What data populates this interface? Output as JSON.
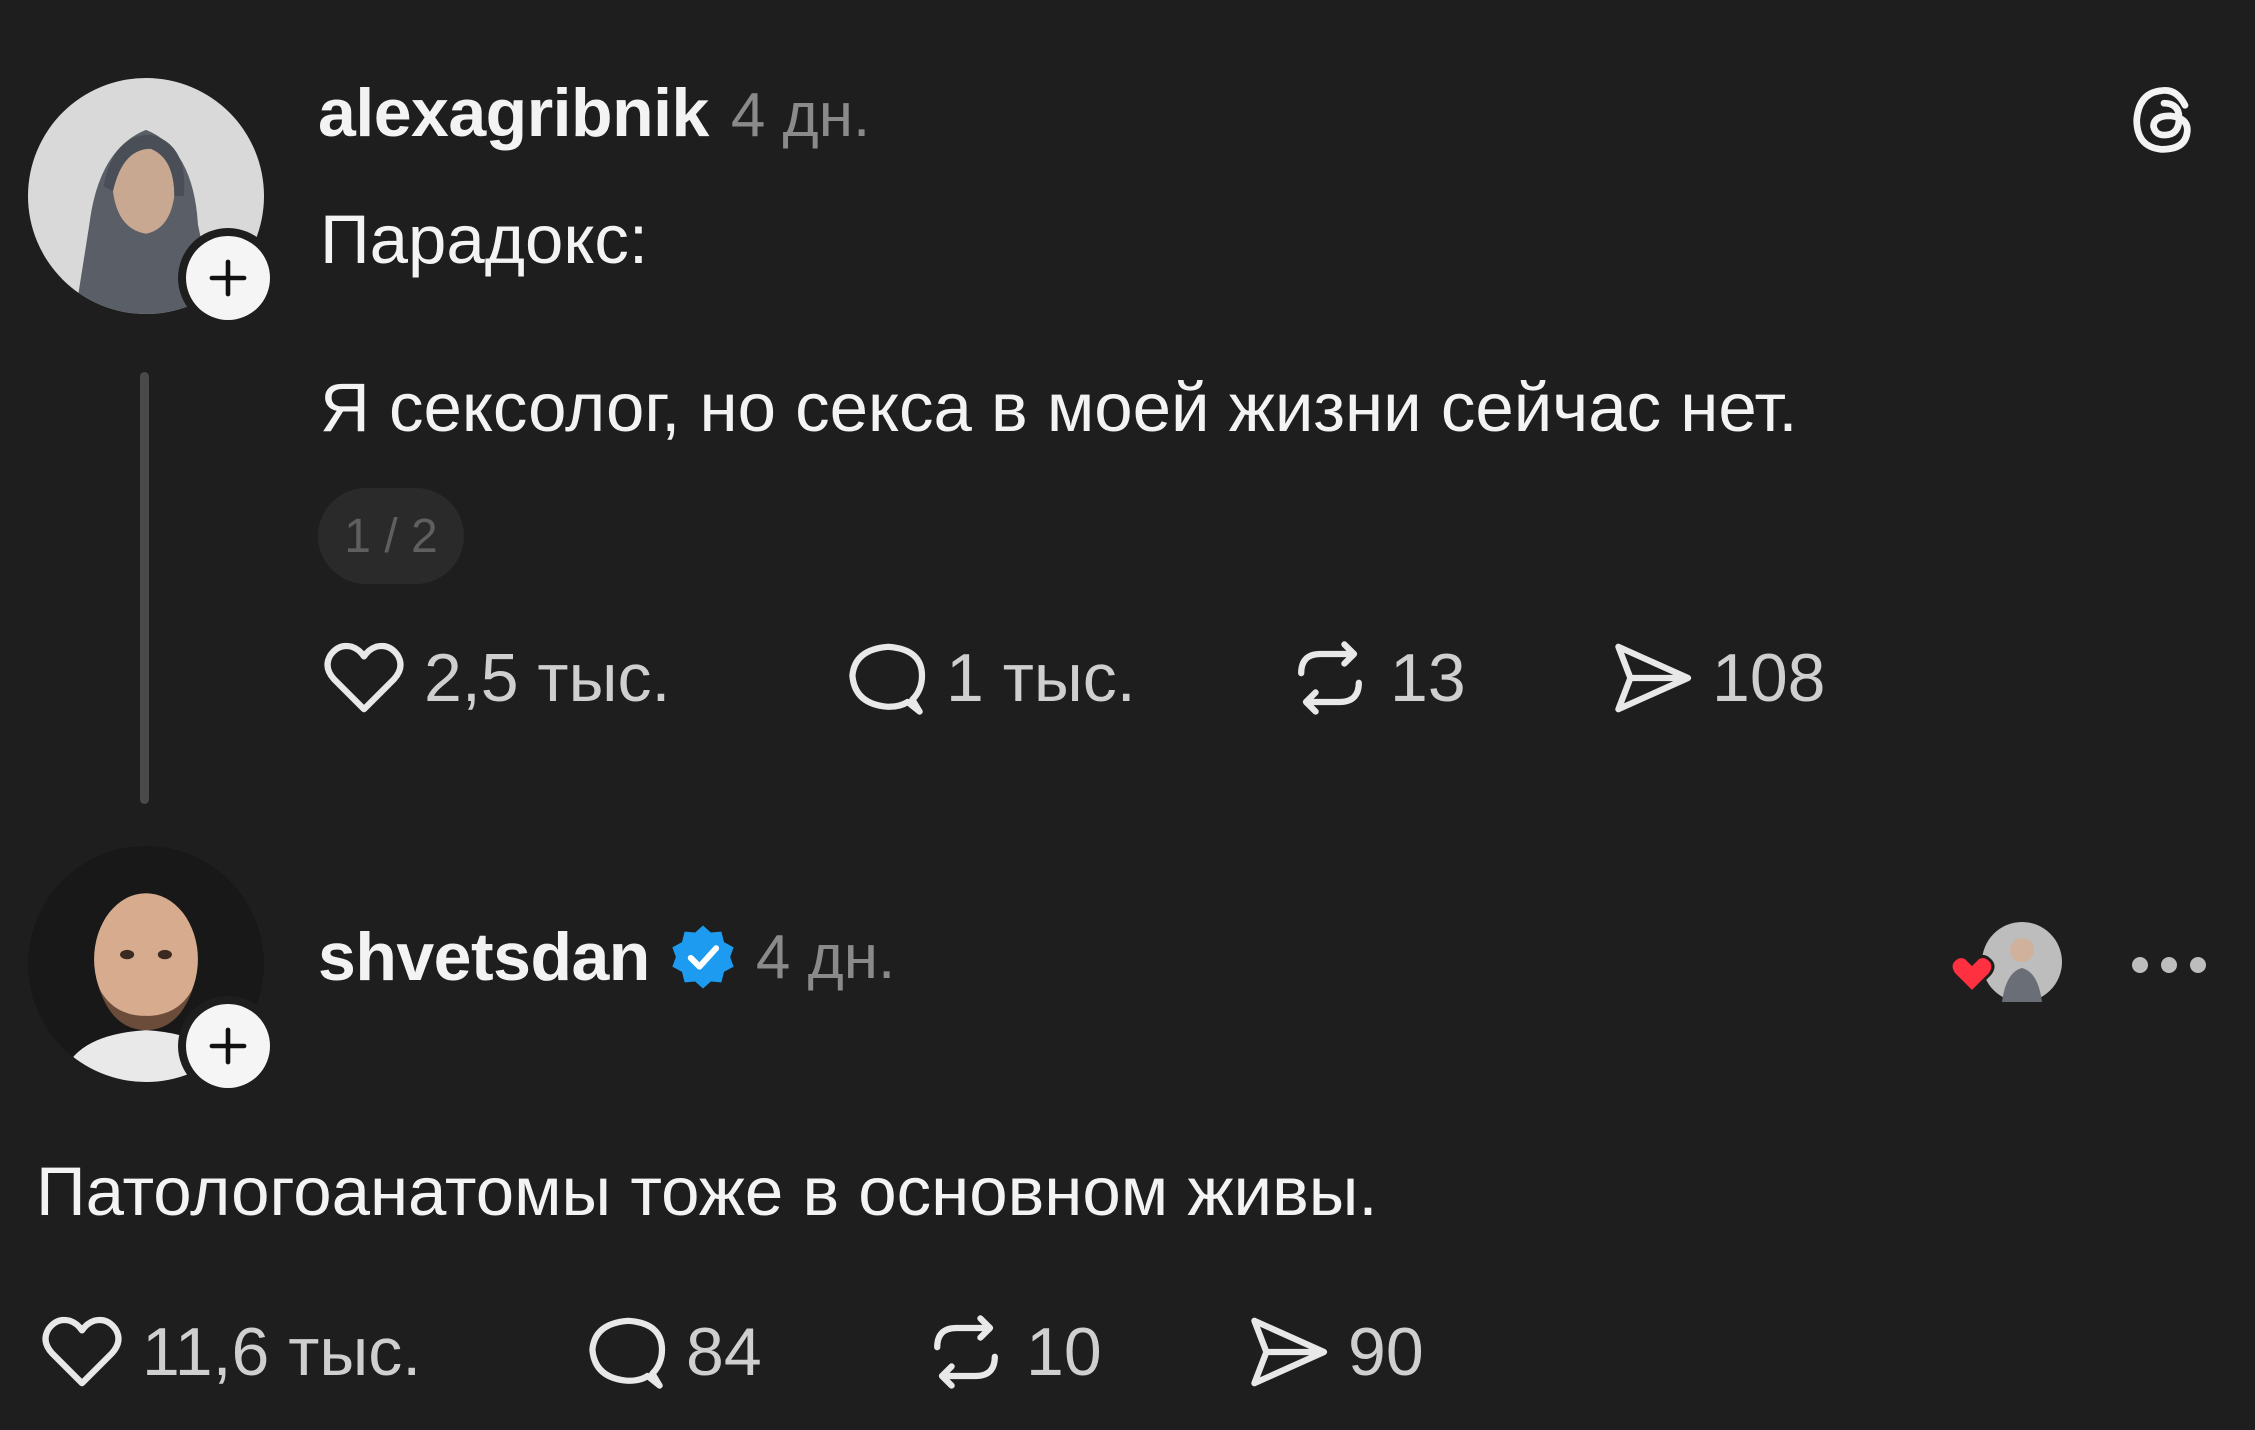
{
  "posts": [
    {
      "username": "alexagribnik",
      "time": "4 дн.",
      "title": "Парадокс:",
      "body": "Я сексолог, но секса в моей жизни сейчас нет.",
      "page_indicator": "1 / 2",
      "actions": {
        "likes": "2,5 тыс.",
        "comments": "1 тыс.",
        "reposts": "13",
        "shares": "108"
      }
    },
    {
      "username": "shvetsdan",
      "verified": true,
      "time": "4 дн.",
      "body": "Патологоанатомы тоже в основном живы.",
      "actions": {
        "likes": "11,6 тыс.",
        "comments": "84",
        "reposts": "10",
        "shares": "90"
      }
    }
  ],
  "icons": {
    "app_logo": "threads-logo-icon",
    "like": "heart-icon",
    "comment": "comment-bubble-icon",
    "repost": "repost-icon",
    "share": "send-icon",
    "more": "more-dots-icon",
    "verified": "verified-badge-icon",
    "follow": "plus-icon"
  },
  "colors": {
    "background": "#1e1e1e",
    "text": "#f3f3f3",
    "muted": "#8a8a8a",
    "verified_blue": "#1d9bf0",
    "liked_heart": "#ff3040"
  }
}
